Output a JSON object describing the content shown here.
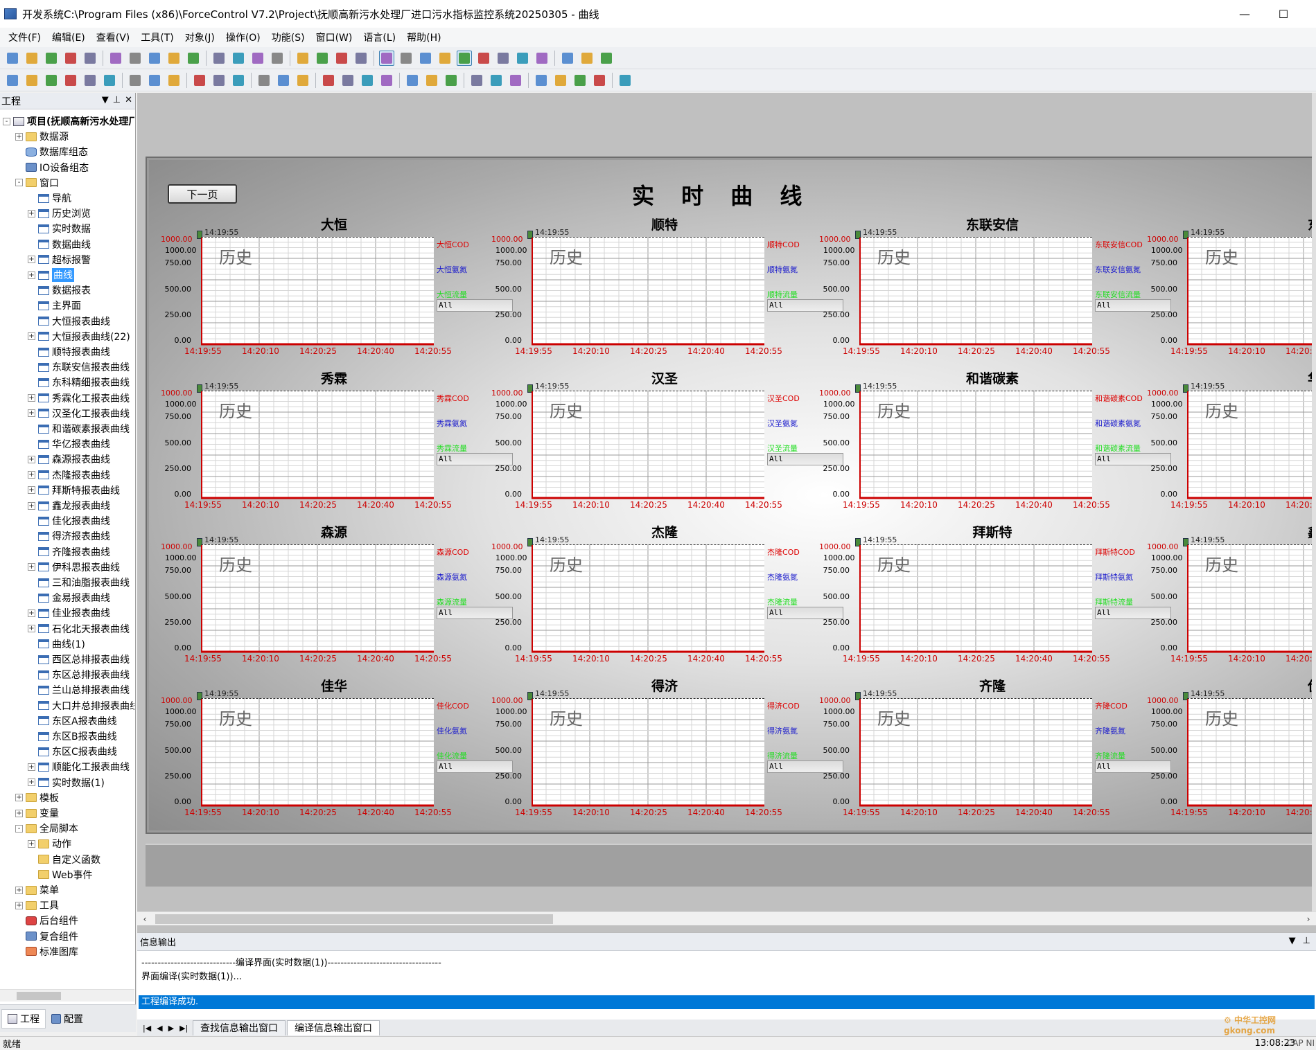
{
  "window": {
    "title": "开发系统C:\\Program Files (x86)\\ForceControl V7.2\\Project\\抚顺高新污水处理厂进口污水指标监控系统20250305 - 曲线",
    "minimize": "—",
    "maximize": "☐"
  },
  "menu": [
    "文件(F)",
    "编辑(E)",
    "查看(V)",
    "工具(T)",
    "对象(J)",
    "操作(O)",
    "功能(S)",
    "窗口(W)",
    "语言(L)",
    "帮助(H)"
  ],
  "toolbar1": [
    "new",
    "open",
    "folder",
    "save",
    "save-all",
    "sep",
    "cut",
    "copy",
    "paste",
    "undo",
    "redo",
    "sep",
    "export",
    "import",
    "layers",
    "grid",
    "sep",
    "db",
    "find",
    "curve",
    "display",
    "sep",
    "window-prop",
    "window-prop2",
    "color",
    "tools",
    "globe-active",
    "runtime",
    "palette",
    "object",
    "dev",
    "sep",
    "chart-a",
    "chart-b",
    "chart-c"
  ],
  "toolbar2": [
    "align-left",
    "align-center",
    "align-right",
    "align-top",
    "align-mid",
    "align-bottom",
    "sep",
    "space-h",
    "space-v",
    "center",
    "sep",
    "same-w",
    "same-h",
    "same-size",
    "sep",
    "flip-h",
    "flip-v",
    "rotate",
    "sep",
    "group",
    "ungroup",
    "front",
    "back",
    "sep",
    "lock",
    "screen",
    "unlock",
    "sep",
    "import2",
    "add",
    "layer",
    "sep",
    "copy-fmt",
    "paste-fmt",
    "text",
    "abc",
    "sep",
    "expand"
  ],
  "left_panel": {
    "title": "工程",
    "tree": [
      {
        "label": "项目(抚顺高新污水处理厂",
        "level": 0,
        "icon": "proj",
        "expand": "-",
        "bold": true
      },
      {
        "label": "数据源",
        "level": 1,
        "icon": "folder",
        "expand": "+"
      },
      {
        "label": "数据库组态",
        "level": 1,
        "icon": "db",
        "expand": ""
      },
      {
        "label": "IO设备组态",
        "level": 1,
        "icon": "io",
        "expand": ""
      },
      {
        "label": "窗口",
        "level": 1,
        "icon": "folder",
        "expand": "-"
      },
      {
        "label": "导航",
        "level": 2,
        "icon": "window",
        "expand": ""
      },
      {
        "label": "历史浏览",
        "level": 2,
        "icon": "window",
        "expand": "+"
      },
      {
        "label": "实时数据",
        "level": 2,
        "icon": "window",
        "expand": ""
      },
      {
        "label": "数据曲线",
        "level": 2,
        "icon": "window",
        "expand": ""
      },
      {
        "label": "超标报警",
        "level": 2,
        "icon": "window",
        "expand": "+"
      },
      {
        "label": "曲线",
        "level": 2,
        "icon": "window",
        "expand": "+",
        "selected": true
      },
      {
        "label": "数据报表",
        "level": 2,
        "icon": "window",
        "expand": ""
      },
      {
        "label": "主界面",
        "level": 2,
        "icon": "window",
        "expand": ""
      },
      {
        "label": "大恒报表曲线",
        "level": 2,
        "icon": "window",
        "expand": ""
      },
      {
        "label": "大恒报表曲线(22)",
        "level": 2,
        "icon": "window",
        "expand": "+"
      },
      {
        "label": "顺特报表曲线",
        "level": 2,
        "icon": "window",
        "expand": ""
      },
      {
        "label": "东联安信报表曲线",
        "level": 2,
        "icon": "window",
        "expand": ""
      },
      {
        "label": "东科精细报表曲线",
        "level": 2,
        "icon": "window",
        "expand": ""
      },
      {
        "label": "秀霖化工报表曲线",
        "level": 2,
        "icon": "window",
        "expand": "+"
      },
      {
        "label": "汉圣化工报表曲线",
        "level": 2,
        "icon": "window",
        "expand": "+"
      },
      {
        "label": "和谐碳素报表曲线",
        "level": 2,
        "icon": "window",
        "expand": ""
      },
      {
        "label": "华亿报表曲线",
        "level": 2,
        "icon": "window",
        "expand": ""
      },
      {
        "label": "森源报表曲线",
        "level": 2,
        "icon": "window",
        "expand": "+"
      },
      {
        "label": "杰隆报表曲线",
        "level": 2,
        "icon": "window",
        "expand": "+"
      },
      {
        "label": "拜斯特报表曲线",
        "level": 2,
        "icon": "window",
        "expand": "+"
      },
      {
        "label": "鑫龙报表曲线",
        "level": 2,
        "icon": "window",
        "expand": "+"
      },
      {
        "label": "佳化报表曲线",
        "level": 2,
        "icon": "window",
        "expand": ""
      },
      {
        "label": "得济报表曲线",
        "level": 2,
        "icon": "window",
        "expand": ""
      },
      {
        "label": "齐隆报表曲线",
        "level": 2,
        "icon": "window",
        "expand": ""
      },
      {
        "label": "伊科思报表曲线",
        "level": 2,
        "icon": "window",
        "expand": "+"
      },
      {
        "label": "三和油脂报表曲线",
        "level": 2,
        "icon": "window",
        "expand": ""
      },
      {
        "label": "金易报表曲线",
        "level": 2,
        "icon": "window",
        "expand": ""
      },
      {
        "label": "佳业报表曲线",
        "level": 2,
        "icon": "window",
        "expand": "+"
      },
      {
        "label": "石化北天报表曲线",
        "level": 2,
        "icon": "window",
        "expand": "+"
      },
      {
        "label": "曲线(1)",
        "level": 2,
        "icon": "window",
        "expand": ""
      },
      {
        "label": "西区总排报表曲线",
        "level": 2,
        "icon": "window",
        "expand": ""
      },
      {
        "label": "东区总排报表曲线",
        "level": 2,
        "icon": "window",
        "expand": ""
      },
      {
        "label": "兰山总排报表曲线",
        "level": 2,
        "icon": "window",
        "expand": ""
      },
      {
        "label": "大口井总排报表曲线",
        "level": 2,
        "icon": "window",
        "expand": ""
      },
      {
        "label": "东区A报表曲线",
        "level": 2,
        "icon": "window",
        "expand": ""
      },
      {
        "label": "东区B报表曲线",
        "level": 2,
        "icon": "window",
        "expand": ""
      },
      {
        "label": "东区C报表曲线",
        "level": 2,
        "icon": "window",
        "expand": ""
      },
      {
        "label": "顺能化工报表曲线",
        "level": 2,
        "icon": "window",
        "expand": "+"
      },
      {
        "label": "实时数据(1)",
        "level": 2,
        "icon": "window",
        "expand": "+"
      },
      {
        "label": "模板",
        "level": 1,
        "icon": "folder",
        "expand": "+"
      },
      {
        "label": "变量",
        "level": 1,
        "icon": "folder",
        "expand": "+"
      },
      {
        "label": "全局脚本",
        "level": 1,
        "icon": "folder",
        "expand": "-"
      },
      {
        "label": "动作",
        "level": 2,
        "icon": "folder",
        "expand": "+"
      },
      {
        "label": "自定义函数",
        "level": 2,
        "icon": "folder",
        "expand": ""
      },
      {
        "label": "Web事件",
        "level": 2,
        "icon": "folder",
        "expand": ""
      },
      {
        "label": "菜单",
        "level": 1,
        "icon": "folder",
        "expand": "+"
      },
      {
        "label": "工具",
        "level": 1,
        "icon": "folder",
        "expand": "+"
      },
      {
        "label": "后台组件",
        "level": 1,
        "icon": "comp",
        "expand": ""
      },
      {
        "label": "复合组件",
        "level": 1,
        "icon": "io",
        "expand": ""
      },
      {
        "label": "标准图库",
        "level": 1,
        "icon": "lib",
        "expand": ""
      }
    ],
    "tabs": [
      "工程",
      "配置"
    ]
  },
  "screen": {
    "title": "实 时 曲 线",
    "next_button": "下一页",
    "watermark_text": "历史",
    "timestamp": "14:19:55",
    "y_ticks": [
      "1000.00",
      "1000.00",
      "750.00",
      "500.00",
      "250.00",
      "0.00"
    ],
    "x_ticks": [
      "14:19:55",
      "14:20:10",
      "14:20:25",
      "14:20:40",
      "14:20:55"
    ],
    "all_label": "All",
    "panels": [
      {
        "name": "大恒",
        "legend": [
          "大恒COD",
          "大恒氨氮",
          "大恒流量"
        ]
      },
      {
        "name": "顺特",
        "legend": [
          "顺特COD",
          "顺特氨氮",
          "顺特流量"
        ]
      },
      {
        "name": "东联安信",
        "legend": [
          "东联安信COD",
          "东联安信氨氮",
          "东联安信流量"
        ]
      },
      {
        "name": "东科",
        "legend": [
          "",
          "",
          ""
        ]
      },
      {
        "name": "秀霖",
        "legend": [
          "秀霖COD",
          "秀霖氨氮",
          "秀霖流量"
        ]
      },
      {
        "name": "汉圣",
        "legend": [
          "汉圣COD",
          "汉圣氨氮",
          "汉圣流量"
        ]
      },
      {
        "name": "和谐碳素",
        "legend": [
          "和谐碳素COD",
          "和谐碳素氨氮",
          "和谐碳素流量"
        ]
      },
      {
        "name": "华亿",
        "legend": [
          "",
          "",
          ""
        ]
      },
      {
        "name": "森源",
        "legend": [
          "森源COD",
          "森源氨氮",
          "森源流量"
        ]
      },
      {
        "name": "杰隆",
        "legend": [
          "杰隆COD",
          "杰隆氨氮",
          "杰隆流量"
        ]
      },
      {
        "name": "拜斯特",
        "legend": [
          "拜斯特COD",
          "拜斯特氨氮",
          "拜斯特流量"
        ]
      },
      {
        "name": "鑫龙",
        "legend": [
          "",
          "",
          ""
        ]
      },
      {
        "name": "佳华",
        "legend": [
          "佳化COD",
          "佳化氨氮",
          "佳化流量"
        ]
      },
      {
        "name": "得济",
        "legend": [
          "得济COD",
          "得济氨氮",
          "得济流量"
        ]
      },
      {
        "name": "齐隆",
        "legend": [
          "齐隆COD",
          "齐隆氨氮",
          "齐隆流量"
        ]
      },
      {
        "name": "伊科",
        "legend": [
          "",
          "",
          ""
        ]
      }
    ],
    "legend_colors": [
      "#dd0000",
      "#1a1acc",
      "#22dd22"
    ]
  },
  "info_output": {
    "title": "信息输出",
    "lines": [
      "-----------------------------编译界面(实时数据(1))-----------------------------------",
      "界面编译(实时数据(1))...",
      "工程编译成功."
    ],
    "tabs": [
      "查找信息输出窗口",
      "编译信息输出窗口"
    ]
  },
  "status": {
    "left": "就绪",
    "time": "13:08:23",
    "cap": "CAP NI"
  },
  "watermark": "中华工控网 gkong.com"
}
